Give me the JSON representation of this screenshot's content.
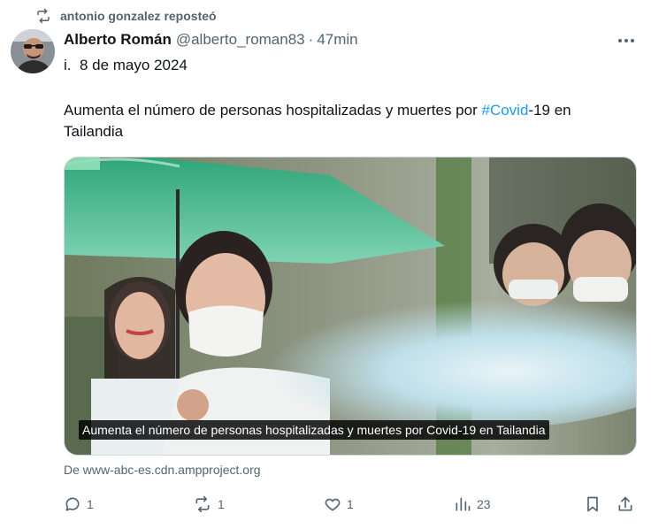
{
  "repost": {
    "text": "antonio gonzalez reposteó",
    "icon": "repost-icon"
  },
  "author": {
    "name": "Alberto Román",
    "handle": "@alberto_roman83",
    "separator": "·",
    "time": "47min"
  },
  "date_line": "i.  8 de mayo 2024",
  "body": {
    "text_before": "Aumenta el número de personas hospitalizadas y muertes por ",
    "hashtag": "#Covid",
    "text_after": "-19 en Tailandia"
  },
  "media": {
    "caption": "Aumenta el número de personas hospitalizadas y muertes por Covid-19 en Tailandia"
  },
  "link_source": "De www-abc-es.cdn.ampproject.org",
  "actions": {
    "replies": "1",
    "reposts": "1",
    "likes": "1",
    "views": "23"
  },
  "colors": {
    "accent": "#1d9bf0",
    "secondary_text": "#536471",
    "primary_text": "#0f1419"
  }
}
